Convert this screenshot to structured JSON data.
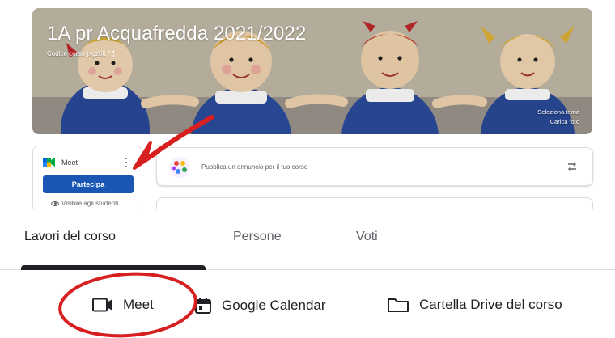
{
  "banner": {
    "title": "1A pr Acquafredda 2021/2022",
    "course_code_label": "Codice corso",
    "course_code": "jxgz6lt",
    "select_theme": "Seleziona tema",
    "upload_photo": "Carica foto"
  },
  "meet_card": {
    "label": "Meet",
    "join_button": "Partecipa",
    "visibility_note": "Visibile agli studenti"
  },
  "announcement": {
    "placeholder": "Pubblica un annuncio per il tuo corso"
  },
  "tabs": [
    {
      "label": "Lavori del corso",
      "active": true
    },
    {
      "label": "Persone",
      "active": false
    },
    {
      "label": "Voti",
      "active": false
    }
  ],
  "tools": {
    "meet": "Meet",
    "calendar": "Google Calendar",
    "drive": "Cartella Drive del corso"
  },
  "icons": {
    "meet": "video-camera-icon",
    "calendar": "calendar-icon",
    "drive": "folder-icon",
    "more": "more-vert-icon",
    "repost": "repost-icon",
    "eye": "eye-icon"
  },
  "colors": {
    "primary_button": "#1a56b4",
    "annotation": "#d81f1f",
    "text_dark": "#202124",
    "text_muted": "#5f6368"
  }
}
